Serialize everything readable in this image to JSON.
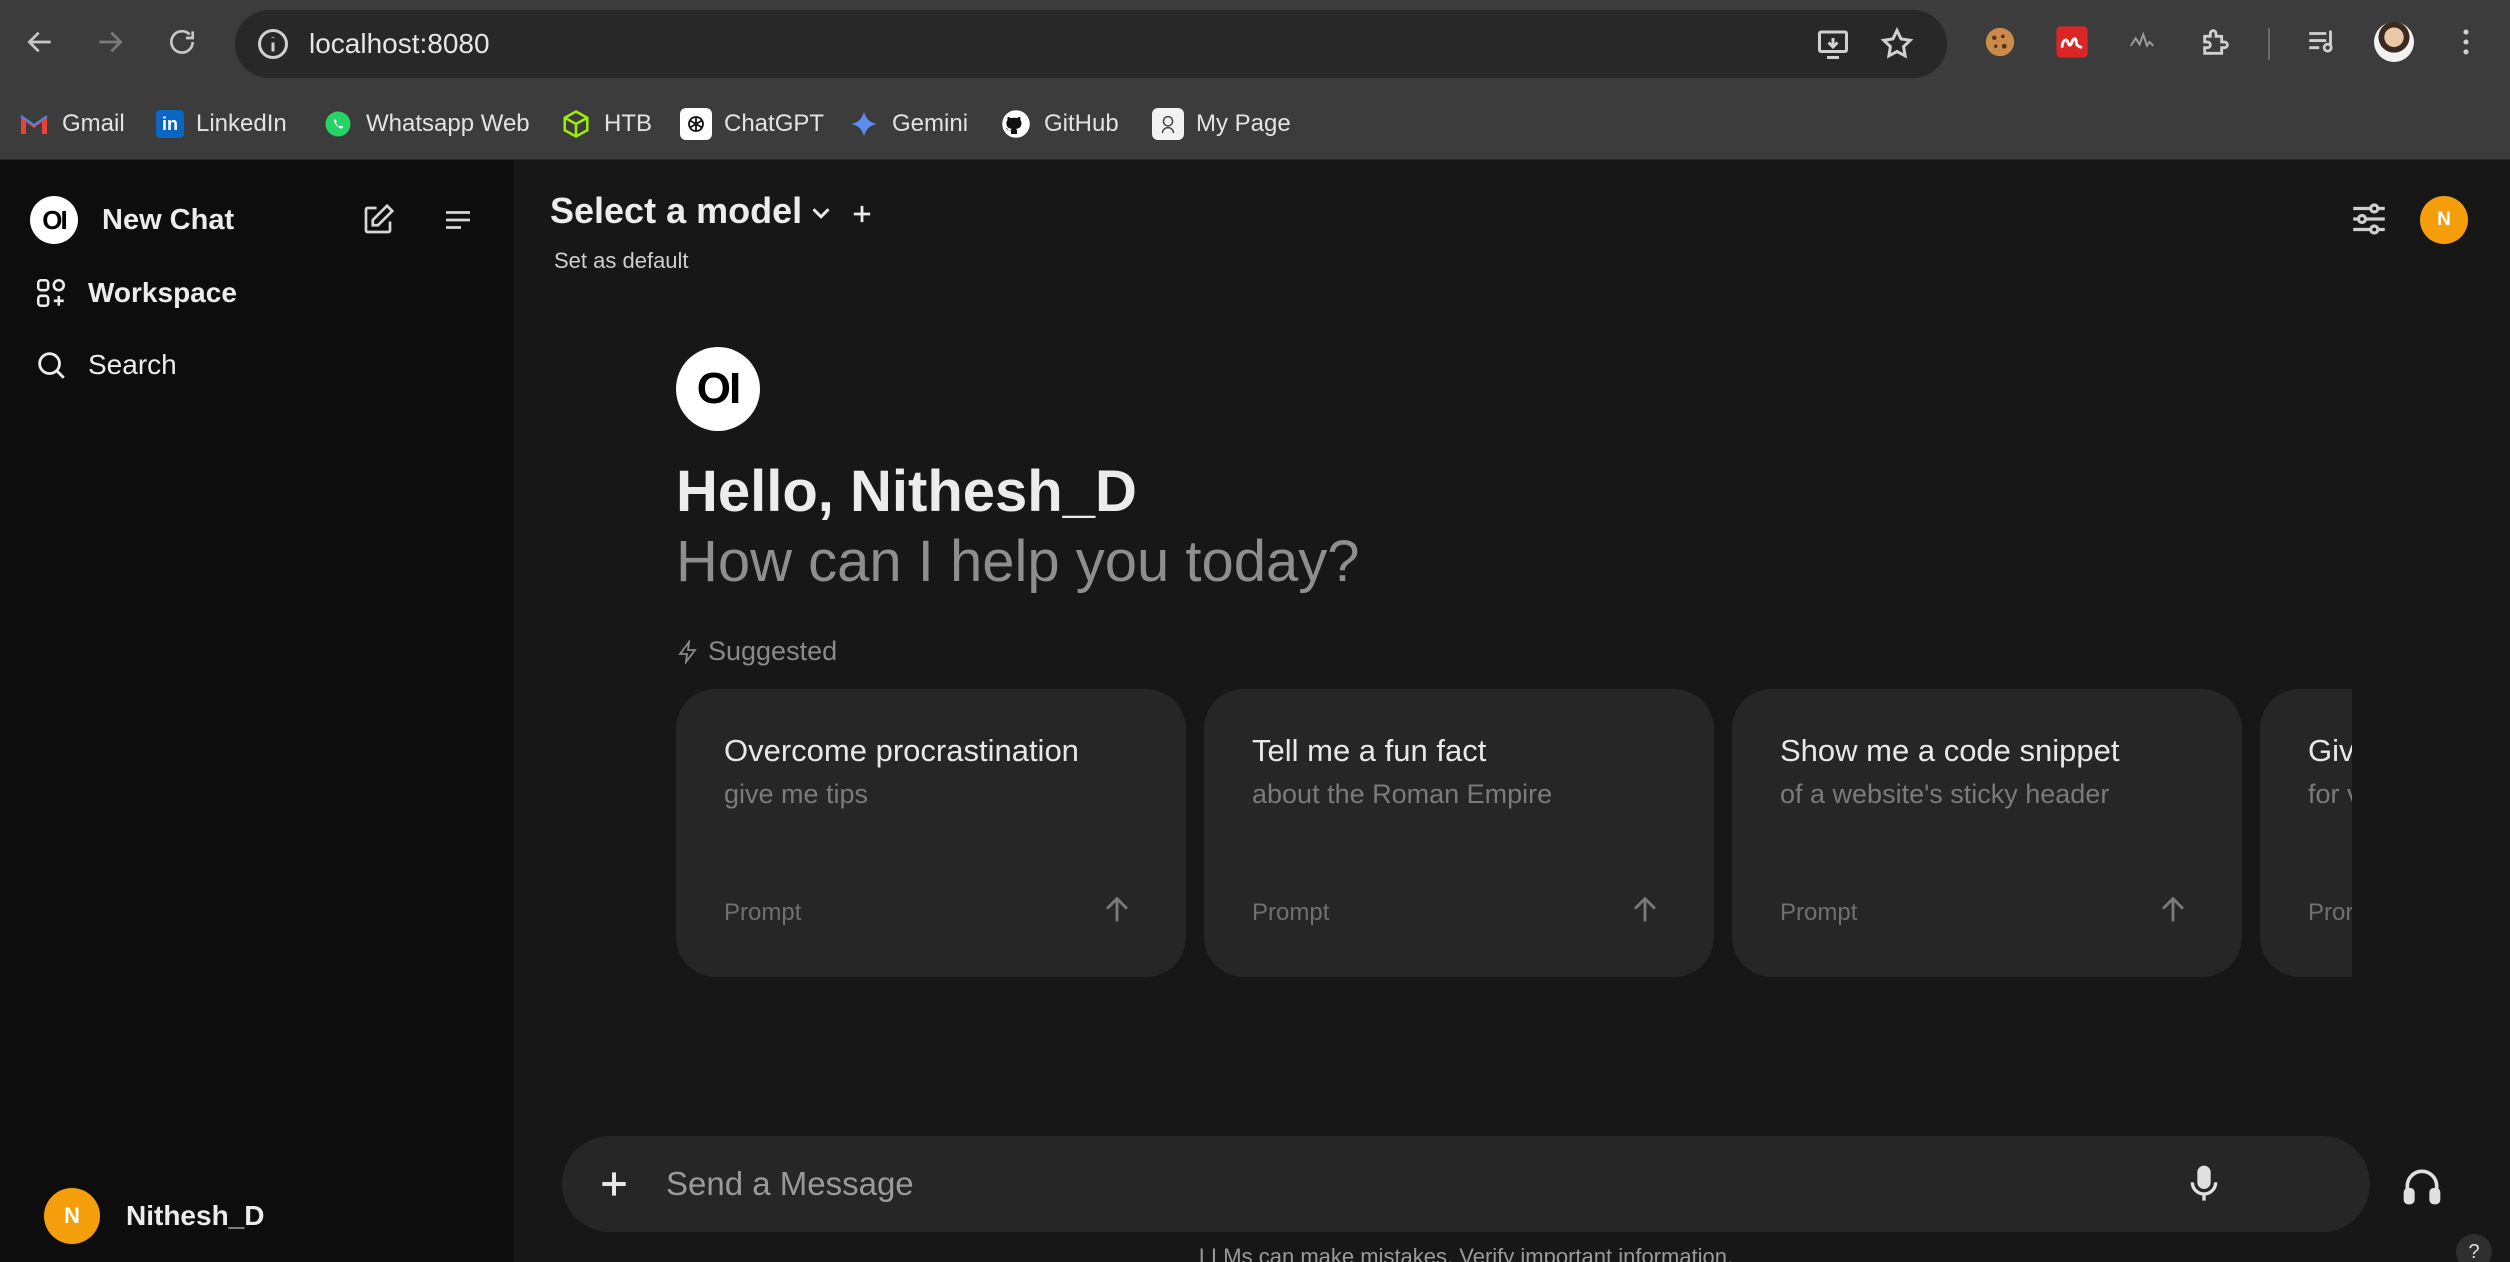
{
  "browser": {
    "url": "localhost:8080",
    "bookmarks": [
      {
        "label": "Gmail",
        "icon": "gmail-icon"
      },
      {
        "label": "LinkedIn",
        "icon": "linkedin-icon"
      },
      {
        "label": "Whatsapp Web",
        "icon": "whatsapp-icon"
      },
      {
        "label": "HTB",
        "icon": "htb-icon"
      },
      {
        "label": "ChatGPT",
        "icon": "chatgpt-icon"
      },
      {
        "label": "Gemini",
        "icon": "gemini-icon"
      },
      {
        "label": "GitHub",
        "icon": "github-icon"
      },
      {
        "label": "My Page",
        "icon": "mypage-icon"
      }
    ]
  },
  "sidebar": {
    "new_chat": "New Chat",
    "workspace": "Workspace",
    "search": "Search",
    "user_name": "Nithesh_D",
    "user_initial": "N"
  },
  "header": {
    "model_title": "Select a model",
    "set_default": "Set as default",
    "user_initial": "N"
  },
  "welcome": {
    "hello": "Hello, Nithesh_D",
    "help": "How can I help you today?",
    "suggested_label": "Suggested"
  },
  "suggestions": [
    {
      "title": "Overcome procrastination",
      "subtitle": "give me tips",
      "label": "Prompt"
    },
    {
      "title": "Tell me a fun fact",
      "subtitle": "about the Roman Empire",
      "label": "Prompt"
    },
    {
      "title": "Show me a code snippet",
      "subtitle": "of a website's sticky header",
      "label": "Prompt"
    },
    {
      "title": "Giv",
      "subtitle": "for v",
      "label": "Pror"
    }
  ],
  "composer": {
    "placeholder": "Send a Message",
    "disclaimer": "LLMs can make mistakes. Verify important information."
  },
  "colors": {
    "avatar": "#f59e0b",
    "sidebar_bg": "#0d0d0d",
    "main_bg": "#171717",
    "card_bg": "#262626"
  }
}
